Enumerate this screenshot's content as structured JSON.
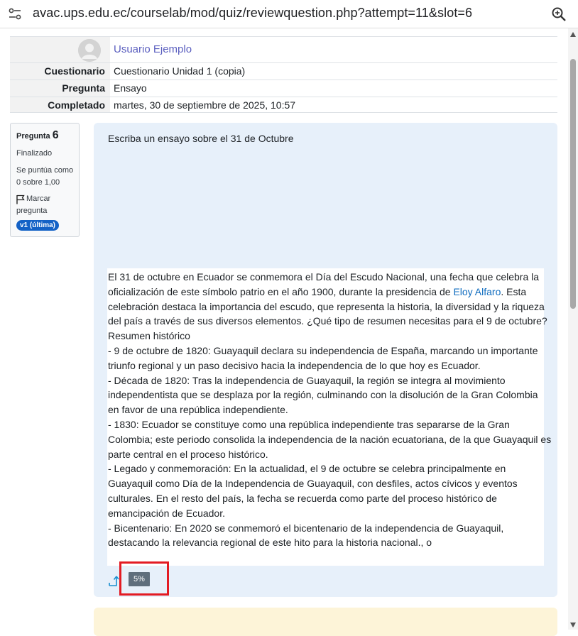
{
  "browser": {
    "url": "avac.ups.edu.ec/courselab/mod/quiz/reviewquestion.php?attempt=11&slot=6",
    "site_icon": "tune-icon",
    "zoom_icon": "zoom-magnifier-icon"
  },
  "header": {
    "user_name": "Usuario Ejemplo",
    "rows": [
      {
        "label": "Cuestionario",
        "value": "Cuestionario Unidad 1 (copia)"
      },
      {
        "label": "Pregunta",
        "value": "Ensayo"
      },
      {
        "label": "Completado",
        "value": "martes, 30 de septiembre de 2025, 10:57"
      }
    ]
  },
  "question_info": {
    "label": "Pregunta",
    "number": "6",
    "state": "Finalizado",
    "grade_line1": "Se puntúa como",
    "grade_line2": "0 sobre 1,00",
    "flag_line1": "Marcar",
    "flag_line2": "pregunta",
    "version": "v1 (última)"
  },
  "question": {
    "text": "Escriba un ensayo sobre el 31 de Octubre",
    "answer_lines": [
      "El 31 de octubre en Ecuador se conmemora el Día del Escudo Nacional, una fecha que celebra la",
      "oficialización de este símbolo patrio en el año 1900, durante la presidencia de ",
      "celebración destaca la importancia del escudo, que representa la historia, la diversidad y la riqueza",
      "del país a través de sus diversos elementos. ¿Qué tipo de resumen necesitas para el 9 de octubre?",
      "Resumen histórico",
      "- 9 de octubre de 1820: Guayaquil declara su independencia de España, marcando un importante",
      "triunfo regional y un paso decisivo hacia la independencia de lo que hoy es Ecuador.",
      "- Década de 1820: Tras la independencia de Guayaquil, la región se integra al movimiento",
      "independentista que se desplaza por la región, culminando con la disolución de la Gran Colombia",
      "en favor de una república independiente.",
      "- 1830: Ecuador se constituye como una república independiente tras separarse de la Gran",
      "Colombia; este periodo consolida la independencia de la nación ecuatoriana, de la que Guayaquil es",
      "parte central en el proceso histórico.",
      "- Legado y conmemoración: En la actualidad, el 9 de octubre se celebra principalmente en",
      "Guayaquil como Día de la Independencia de Guayaquil, con desfiles, actos cívicos y eventos",
      "culturales. En el resto del país, la fecha se recuerda como parte del proceso histórico de",
      "emancipación de Ecuador.",
      "- Bicentenario: En 2020 se conmemoró el bicentenario de la independencia de Guayaquil,",
      "destacando la relevancia regional de este hito para la historia nacional., o"
    ],
    "link_text": "Eloy Alfaro",
    "line2_after_link": ". Esta",
    "ai_percentage": "5%",
    "highlight_color": "#e31b23"
  }
}
